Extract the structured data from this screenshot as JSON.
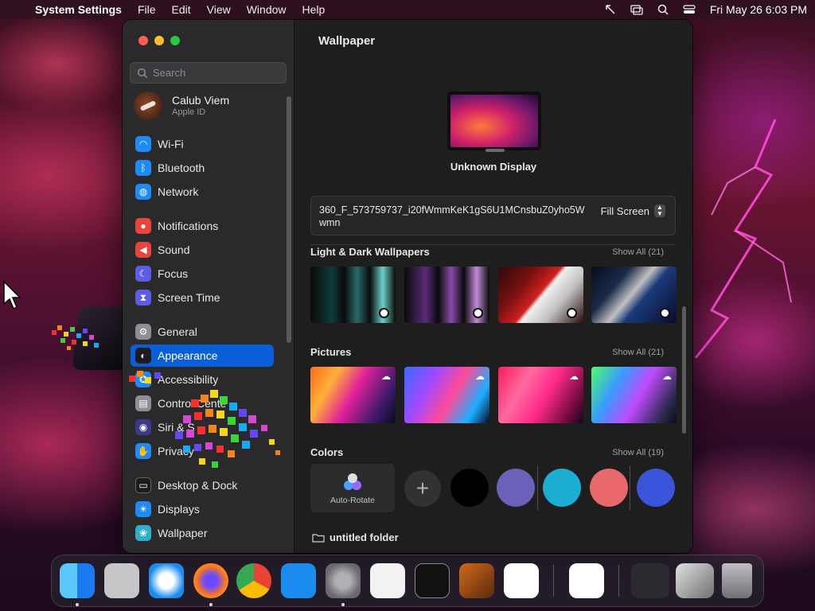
{
  "menubar": {
    "app": "System Settings",
    "items": [
      "File",
      "Edit",
      "View",
      "Window",
      "Help"
    ],
    "clock": "Fri May 26  6:03 PM"
  },
  "sidebar": {
    "search_placeholder": "Search",
    "user": {
      "name": "Calub Viem",
      "subtitle": "Apple ID"
    },
    "items": [
      {
        "label": "Wi-Fi",
        "icon": "wifi-icon",
        "color": "#1d8cf8"
      },
      {
        "label": "Bluetooth",
        "icon": "bluetooth-icon",
        "color": "#1d8cf8"
      },
      {
        "label": "Network",
        "icon": "globe-icon",
        "color": "#1d8cf8"
      },
      {
        "label": "Notifications",
        "icon": "bell-icon",
        "color": "#e5453c"
      },
      {
        "label": "Sound",
        "icon": "speaker-icon",
        "color": "#e5453c"
      },
      {
        "label": "Focus",
        "icon": "moon-icon",
        "color": "#5e5ce6"
      },
      {
        "label": "Screen Time",
        "icon": "hourglass-icon",
        "color": "#5e5ce6"
      },
      {
        "label": "General",
        "icon": "gear-icon",
        "color": "#8e8e93"
      },
      {
        "label": "Appearance",
        "icon": "appearance-icon",
        "color": "#1c1c1e"
      },
      {
        "label": "Accessibility",
        "icon": "accessibility-icon",
        "color": "#1d8cf8"
      },
      {
        "label": "Control Cente",
        "icon": "control-center-icon",
        "color": "#8e8e93"
      },
      {
        "label": "Siri & S",
        "icon": "siri-icon",
        "color": "#3a3a8a"
      },
      {
        "label": "Privacy",
        "icon": "hand-icon",
        "color": "#1d8cf8"
      },
      {
        "label": "Desktop & Dock",
        "icon": "dock-icon",
        "color": "#1c1c1e"
      },
      {
        "label": "Displays",
        "icon": "sun-icon",
        "color": "#1d8cf8"
      },
      {
        "label": "Wallpaper",
        "icon": "wallpaper-icon",
        "color": "#30b0c7"
      }
    ],
    "selected": "Appearance"
  },
  "content": {
    "title": "Wallpaper",
    "display_name": "Unknown Display",
    "file_name": "360_F_573759737_i20fWmmKeK1gS6U1MCnsbuZ0yho5Wwmn",
    "fill_mode": "Fill Screen",
    "sections": {
      "light_dark": {
        "title": "Light & Dark Wallpapers",
        "show_all": "Show All (21)"
      },
      "pictures": {
        "title": "Pictures",
        "show_all": "Show All (21)"
      },
      "colors": {
        "title": "Colors",
        "show_all": "Show All (19)"
      }
    },
    "auto_rotate_label": "Auto-Rotate",
    "swatches": [
      "#000000",
      "#6b61b8",
      "#1aaed3",
      "#e8686c",
      "#3a55d9"
    ],
    "folder_label": "untitled folder"
  },
  "dock": {
    "apps": [
      {
        "name": "finder-app",
        "color": "#2a8cf0",
        "running": true
      },
      {
        "name": "launchpad-app",
        "color": "#c6c6c8",
        "running": false
      },
      {
        "name": "safari-app",
        "color": "#1a8cf0",
        "running": false
      },
      {
        "name": "firefox-app",
        "color": "#ff7a1a",
        "running": true
      },
      {
        "name": "chrome-app",
        "color": "#e8e8e8",
        "running": false
      },
      {
        "name": "app-store-app",
        "color": "#1a8cf0",
        "running": false
      },
      {
        "name": "system-settings-app",
        "color": "#8a8a8e",
        "running": true
      },
      {
        "name": "textedit-app",
        "color": "#f2f2f2",
        "running": false
      },
      {
        "name": "terminal-app",
        "color": "#111111",
        "running": false
      },
      {
        "name": "garageband-app",
        "color": "#a0522d",
        "running": false
      },
      {
        "name": "vscode-app",
        "color": "#ffffff",
        "running": false
      },
      {
        "name": "visual-studio-app",
        "color": "#ffffff",
        "running": false
      }
    ]
  }
}
